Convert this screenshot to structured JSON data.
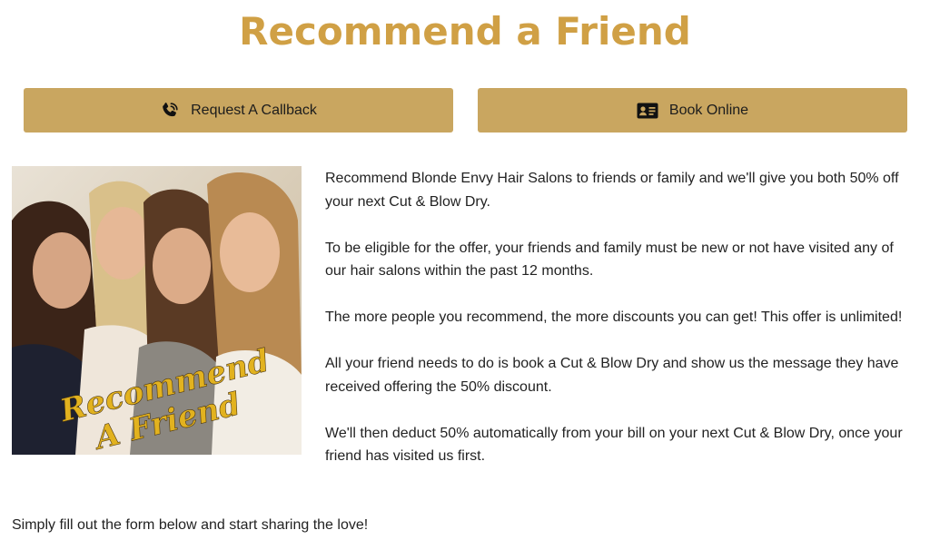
{
  "title": "Recommend a Friend",
  "buttons": {
    "callback": {
      "label": "Request A Callback",
      "icon": "phone-icon"
    },
    "book": {
      "label": "Book Online",
      "icon": "id-card-icon"
    }
  },
  "hero": {
    "overlay_line1": "Recommend",
    "overlay_line2": "A Friend"
  },
  "paragraphs": [
    "Recommend Blonde Envy Hair Salons to friends or family and we'll give you both 50% off your next Cut & Blow Dry.",
    "To be eligible for the offer, your friends and family must be new or not have visited any of our hair salons within the past 12 months.",
    "The more people you recommend, the more discounts you can get!  This offer is unlimited!",
    "All your friend needs to do is book a Cut & Blow Dry and show us the message they have received offering the 50% discount.",
    "We'll then deduct 50% automatically from your bill on your next Cut & Blow Dry, once your friend has visited us first."
  ],
  "footer": "Simply fill out the form below and start sharing the love!",
  "colors": {
    "title": "#d0a045",
    "button": "#c9a660",
    "overlay_text": "#e2b21f"
  }
}
